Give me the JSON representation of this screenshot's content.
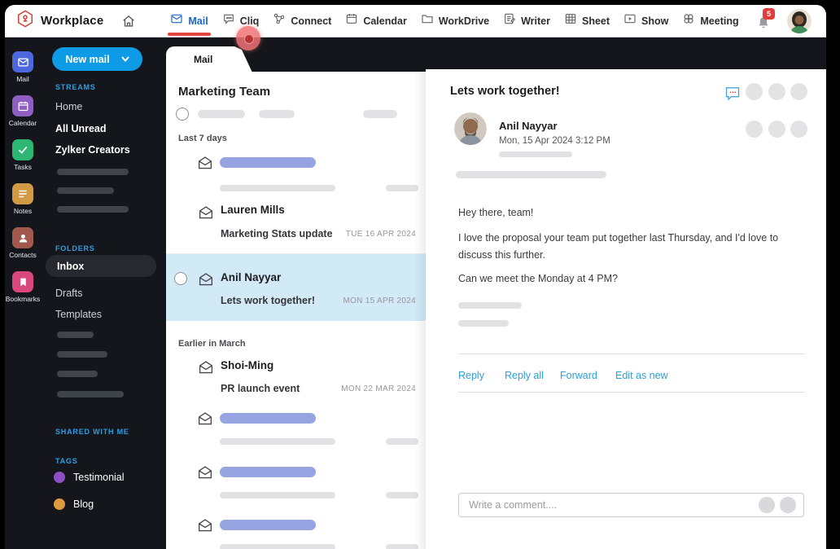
{
  "topbar": {
    "brand": "Workplace",
    "nav": [
      {
        "label": "Mail",
        "active": true
      },
      {
        "label": "Cliq"
      },
      {
        "label": "Connect"
      },
      {
        "label": "Calendar"
      },
      {
        "label": "WorkDrive"
      },
      {
        "label": "Writer"
      },
      {
        "label": "Sheet"
      },
      {
        "label": "Show"
      },
      {
        "label": "Meeting"
      }
    ],
    "notification_count": "5"
  },
  "rail": {
    "items": [
      {
        "label": "Mail",
        "color": "#4d68dd"
      },
      {
        "label": "Calendar",
        "color": "#8e5ec2"
      },
      {
        "label": "Tasks",
        "color": "#2db573"
      },
      {
        "label": "Notes",
        "color": "#d29a45"
      },
      {
        "label": "Contacts",
        "color": "#a2594d"
      },
      {
        "label": "Bookmarks",
        "color": "#d9487c"
      }
    ]
  },
  "sidebar": {
    "new_mail_label": "New mail",
    "streams_title": "STREAMS",
    "streams": [
      "Home",
      "All Unread",
      "Zylker Creators"
    ],
    "folders_title": "FOLDERS",
    "folders": [
      "Inbox",
      "Drafts",
      "Templates"
    ],
    "shared_title": "SHARED WITH ME",
    "tags_title": "TAGS",
    "tags": [
      {
        "label": "Testimonial",
        "color": "#8d4fc4"
      },
      {
        "label": "Blog",
        "color": "#dd9a3f"
      }
    ]
  },
  "list": {
    "tab_label": "Mail",
    "title": "Marketing Team",
    "group_recent": "Last 7 days",
    "group_older": "Earlier in March",
    "items": [
      {
        "sender": "Lauren Mills",
        "subject": "Marketing Stats update",
        "date": "TUE 16 APR 2024"
      },
      {
        "sender": "Anil Nayyar",
        "subject": "Lets work together!",
        "date": "MON 15 APR 2024",
        "selected": true
      },
      {
        "sender": "Shoi-Ming",
        "subject": "PR launch event",
        "date": "MON 22 MAR 2024"
      }
    ]
  },
  "reader": {
    "subject": "Lets work together!",
    "sender": "Anil Nayyar",
    "datetime": "Mon,  15 Apr 2024  3:12 PM",
    "body_p1": "Hey there, team!",
    "body_p2": "I love the proposal your team put together last Thursday, and I'd love to\ndiscuss this further.",
    "body_p3": "Can we meet the Monday at 4 PM?",
    "actions": [
      "Reply",
      "Reply all",
      "Forward",
      "Edit as new"
    ],
    "comment_placeholder": "Write a comment...."
  },
  "colors": {
    "accent_blue": "#0d9be6",
    "nav_active_blue": "#1a66c7",
    "nav_underline_red": "#e4453c",
    "selected_row_blue": "#d2eaf6",
    "skeleton_blue": "#96a5e2",
    "link_blue": "#2e9fd9",
    "badge_red": "#e23b3b",
    "section_label_blue": "#2e9fe6"
  }
}
